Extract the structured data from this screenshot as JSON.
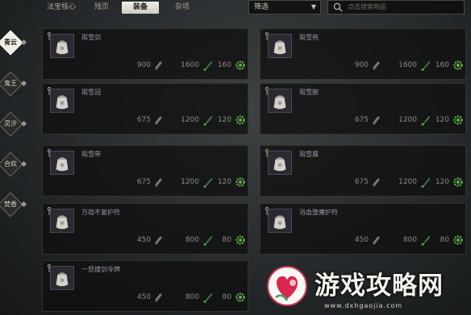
{
  "tabs": [
    {
      "label": "法宝核心",
      "active": false
    },
    {
      "label": "残页",
      "active": false
    },
    {
      "label": "装备",
      "active": true
    },
    {
      "label": "杂项",
      "active": false
    }
  ],
  "filter": {
    "label": "筛选",
    "arrow": "▼"
  },
  "search": {
    "placeholder": "点击搜索物品"
  },
  "sidebar": [
    {
      "label": "青云",
      "active": true
    },
    {
      "label": "鬼王",
      "active": false
    },
    {
      "label": "灵汐",
      "active": false
    },
    {
      "label": "合欢",
      "active": false
    },
    {
      "label": "焚香",
      "active": false
    }
  ],
  "items": [
    {
      "name": "瑕雪剑",
      "stat1": "900",
      "stat2": "1600",
      "stat3": "160"
    },
    {
      "name": "瑕雪袍",
      "stat1": "900",
      "stat2": "1600",
      "stat3": "160"
    },
    {
      "name": "瑕雪冠",
      "stat1": "675",
      "stat2": "1200",
      "stat3": "120"
    },
    {
      "name": "瑕雪腕",
      "stat1": "675",
      "stat2": "1200",
      "stat3": "120"
    },
    {
      "name": "瑕雪带",
      "stat1": "675",
      "stat2": "1200",
      "stat3": "120"
    },
    {
      "name": "瑕雪履",
      "stat1": "675",
      "stat2": "1200",
      "stat3": "120"
    },
    {
      "name": "万劫不复护符",
      "stat1": "450",
      "stat2": "800",
      "stat3": "80"
    },
    {
      "name": "浴血堕魔护符",
      "stat1": "450",
      "stat2": "800",
      "stat3": "80"
    },
    {
      "name": "一怒拔剑令牌",
      "stat1": "450",
      "stat2": "800",
      "stat3": "80"
    }
  ],
  "icons": {
    "search": "magnifier-icon",
    "item": "bag-icon",
    "stat1": "scroll-icon",
    "stat2": "brush-icon",
    "stat3": "gear-icon"
  },
  "colors": {
    "accent": "#f0ede4",
    "stat3": "#5fae4a",
    "item_border": "#4b4657"
  },
  "watermark": {
    "title": "游戏攻略网",
    "url": "www.dxhgaojia.com"
  }
}
